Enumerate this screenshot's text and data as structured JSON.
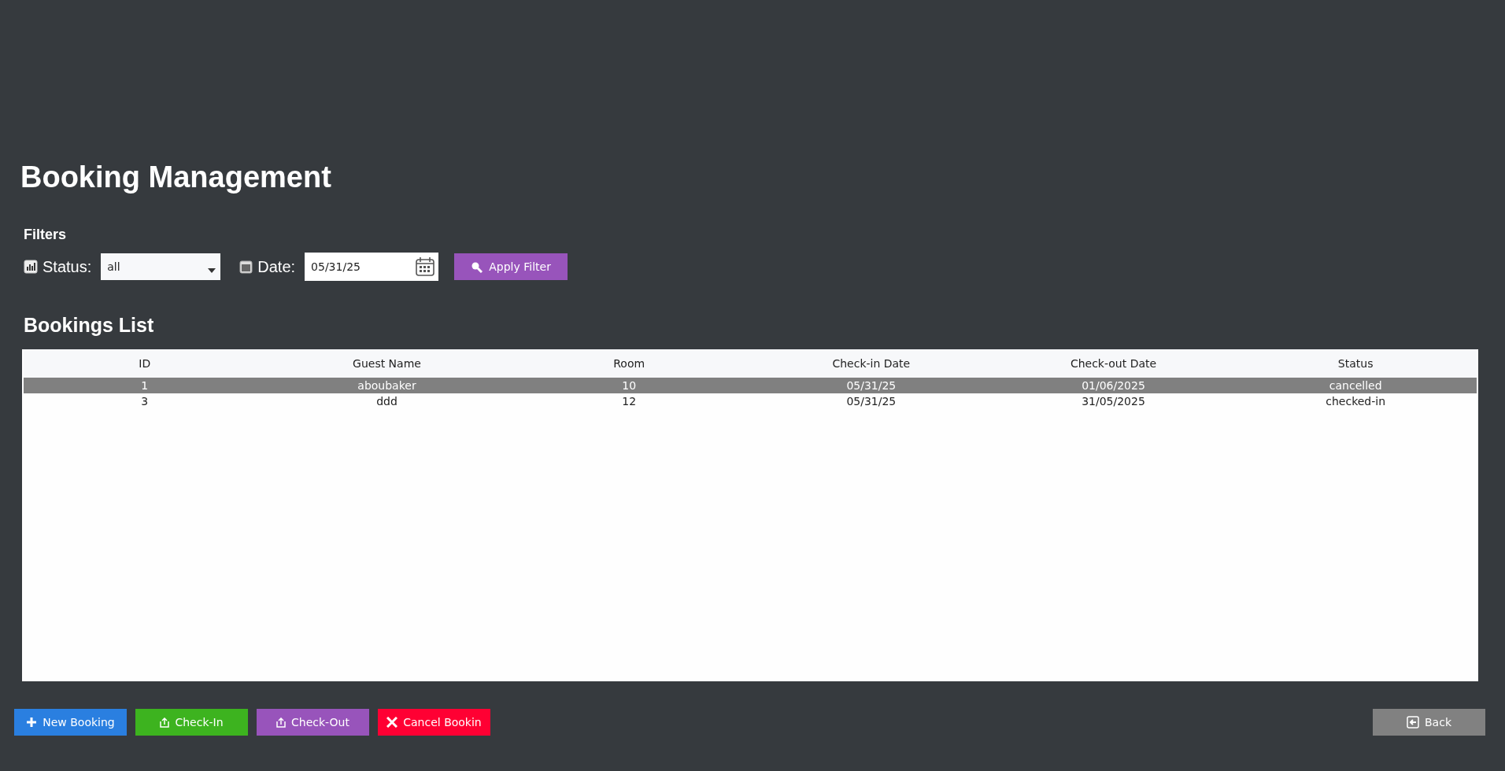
{
  "title": "Booking Management",
  "filters": {
    "heading": "Filters",
    "status_label": "Status:",
    "status_value": "all",
    "date_label": "Date:",
    "date_value": "05/31/25",
    "apply_button": "Apply Filter"
  },
  "bookings": {
    "heading": "Bookings List",
    "columns": [
      "ID",
      "Guest Name",
      "Room",
      "Check-in Date",
      "Check-out Date",
      "Status"
    ],
    "rows": [
      {
        "selected": true,
        "cells": [
          "1",
          "aboubaker",
          "10",
          "05/31/25",
          "01/06/2025",
          "cancelled"
        ]
      },
      {
        "selected": false,
        "cells": [
          "3",
          "ddd",
          "12",
          "05/31/25",
          "31/05/2025",
          "checked-in"
        ]
      }
    ]
  },
  "actions": [
    {
      "label": "New Booking",
      "kind": "plus",
      "color": "#2a7fe0"
    },
    {
      "label": "Check-In",
      "kind": "tray",
      "color": "#3db31f"
    },
    {
      "label": "Check-Out",
      "kind": "tray",
      "color": "#9854bb"
    },
    {
      "label": "Cancel Bookin",
      "kind": "cross",
      "color": "#ff0033"
    }
  ],
  "back_button": {
    "label": "Back",
    "kind": "back",
    "color": "#818181"
  }
}
